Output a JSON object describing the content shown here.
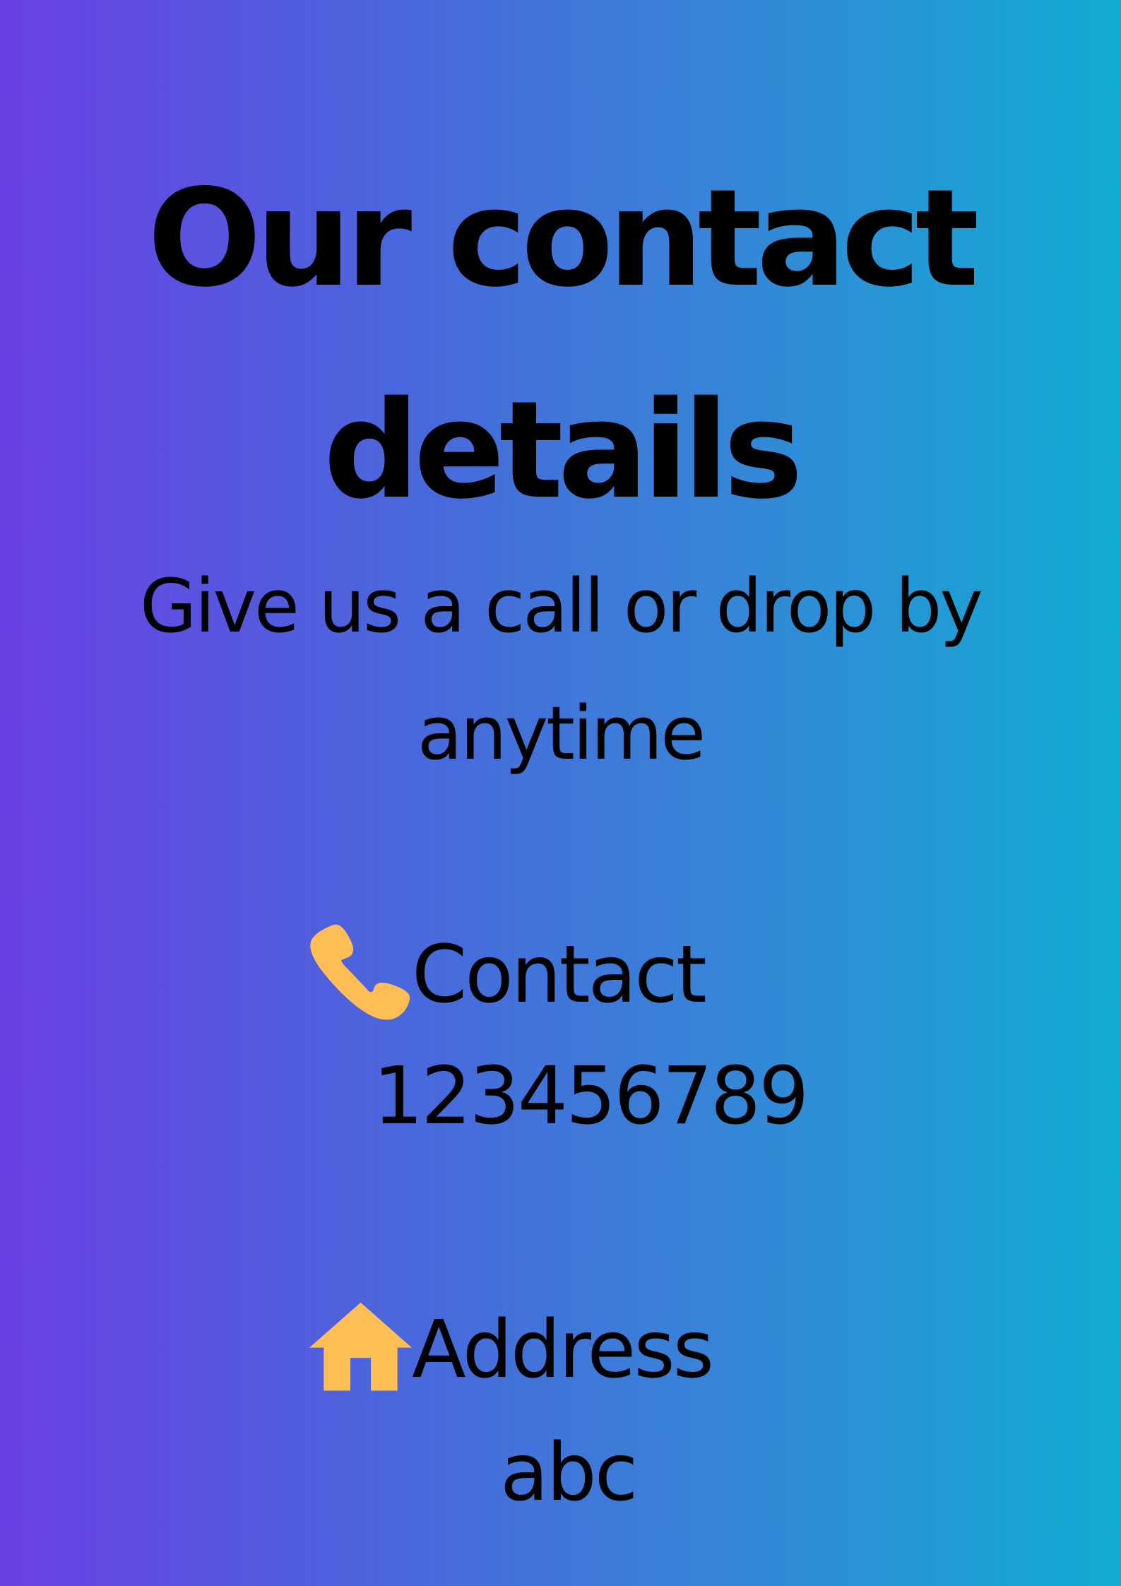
{
  "heading": {
    "line1": "Our contact",
    "line2": "details"
  },
  "subheading": {
    "line1": "Give us a call or drop by",
    "line2": "anytime"
  },
  "contact": {
    "icon": "phone-icon",
    "label": "Contact",
    "value": "123456789"
  },
  "address": {
    "icon": "house-icon",
    "label": "Address",
    "value": "abc"
  },
  "colors": {
    "gradient_start": "#6a3fe3",
    "gradient_end": "#12acd2",
    "icon": "#ffbe55",
    "text": "#000000"
  }
}
